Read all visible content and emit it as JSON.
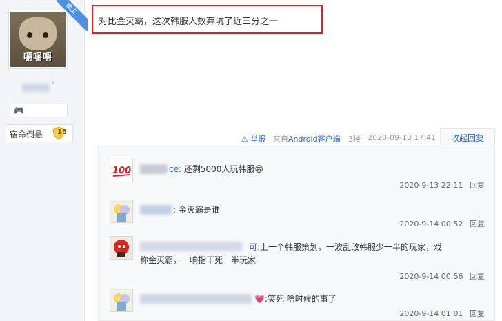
{
  "sidebar": {
    "avatar_caption": "嚼嚼嚼",
    "ribbon_label": "楼主",
    "username_suffix": "°",
    "badge_name": "宿命倒悬",
    "badge_level": "15"
  },
  "post": {
    "text": "对比金灭霸，这次韩服人数弃坑了近三分之一",
    "report_label": "举报",
    "source_prefix": "来自",
    "source_client": "Android客户端",
    "floor": "3楼",
    "timestamp": "2020-09-13 17:41",
    "collapse_label": "收起回复"
  },
  "replies": [
    {
      "author_visible": "ce",
      "text": "还剩5000人玩韩服",
      "emoji": "😁",
      "time": "2020-9-13 22:11",
      "reply_label": "回复"
    },
    {
      "author_visible": "",
      "text": "金灭霸是谁",
      "time": "2020-9-14 00:52",
      "reply_label": "回复"
    },
    {
      "author_visible": "可",
      "text_line1": ":上一个韩服策划，一波乱改韩服少一半的玩家，戏",
      "text_line2": "称金灭霸，一响指干死一半玩家",
      "time": "2020-9-14 00:56",
      "reply_label": "回复"
    },
    {
      "author_visible": "",
      "text": ":笑死 啥时候的事了",
      "emoji": "💗",
      "time": "2020-9-14 01:01",
      "reply_label": "回复"
    }
  ],
  "colors": {
    "accent_blue": "#2d64b3",
    "highlight_red": "#e02020",
    "ribbon_blue": "#4e8fe0"
  }
}
